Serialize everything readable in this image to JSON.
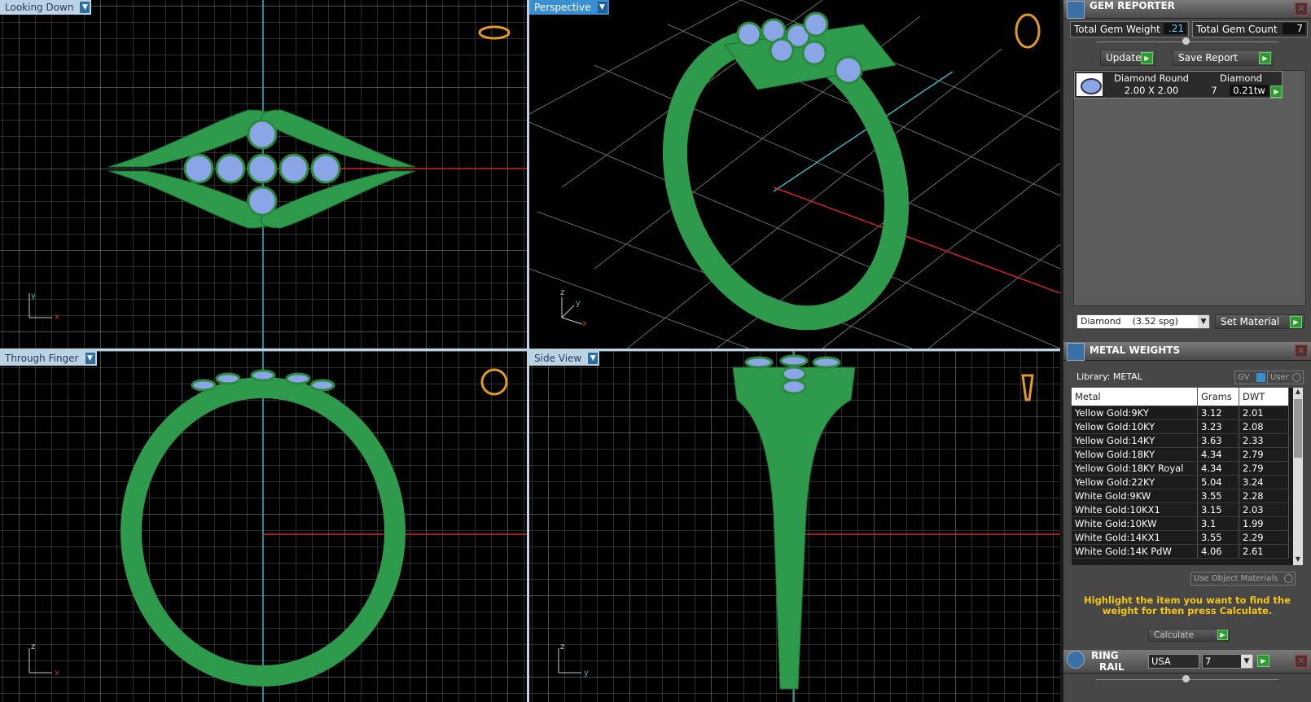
{
  "viewports": {
    "top_left": {
      "label": "Looking Down",
      "axis1": "y",
      "axis2": "x"
    },
    "top_right": {
      "label": "Perspective",
      "axis1": "z",
      "axis2": "y",
      "axis3": "x"
    },
    "bottom_left": {
      "label": "Through Finger",
      "axis1": "z",
      "axis2": "x"
    },
    "bottom_right": {
      "label": "Side View",
      "axis1": "z",
      "axis2": "y"
    }
  },
  "gem_reporter": {
    "title": "GEM REPORTER",
    "total_weight_label": "Total Gem Weight",
    "total_weight_value": ".21",
    "total_count_label": "Total Gem Count",
    "total_count_value": "7",
    "update_label": "Update",
    "save_report_label": "Save Report",
    "gem": {
      "name": "Diamond Round",
      "size": "2.00 X 2.00",
      "material": "Diamond",
      "count": "7",
      "tw": "0.21tw"
    },
    "material_select": "Diamond    (3.52 spg)",
    "set_material_label": "Set Material"
  },
  "metal_weights": {
    "title": "METAL WEIGHTS",
    "library_label": "Library: METAL",
    "gv_label": "GV",
    "user_label": "User",
    "columns": [
      "Metal",
      "Grams",
      "DWT"
    ],
    "rows": [
      [
        "Yellow Gold:9KY",
        "3.12",
        "2.01"
      ],
      [
        "Yellow Gold:10KY",
        "3.23",
        "2.08"
      ],
      [
        "Yellow Gold:14KY",
        "3.63",
        "2.33"
      ],
      [
        "Yellow Gold:18KY",
        "4.34",
        "2.79"
      ],
      [
        "Yellow Gold:18KY Royal",
        "4.34",
        "2.79"
      ],
      [
        "Yellow Gold:22KY",
        "5.04",
        "3.24"
      ],
      [
        "White Gold:9KW",
        "3.55",
        "2.28"
      ],
      [
        "White Gold:10KX1",
        "3.15",
        "2.03"
      ],
      [
        "White Gold:10KW",
        "3.1",
        "1.99"
      ],
      [
        "White Gold:14KX1",
        "3.55",
        "2.29"
      ],
      [
        "White Gold:14K PdW",
        "4.06",
        "2.61"
      ]
    ],
    "use_object_materials": "Use Object Materials",
    "hint": "Highlight the item you want to find the weight for then press Calculate.",
    "calculate_label": "Calculate"
  },
  "ring_rail": {
    "title_line1": "RING",
    "title_line2": "RAIL",
    "country": "USA",
    "size": "7"
  },
  "colors": {
    "ring": "#2e9a4b",
    "gem": "#8aa6e6",
    "accent": "#3a8fd0",
    "hint": "#f5c518"
  }
}
